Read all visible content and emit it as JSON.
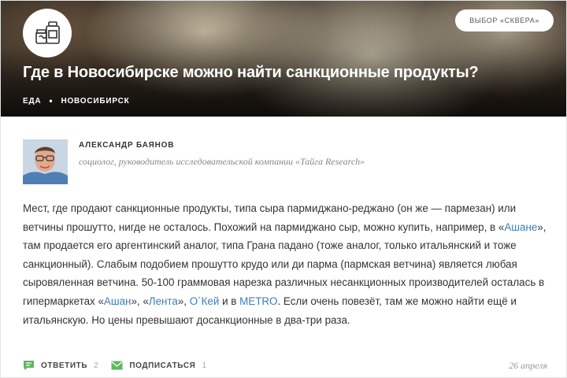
{
  "hero": {
    "choice_button": "ВЫБОР «СКВЕРА»",
    "title": "Где в Новосибирске можно найти санкционные продукты?",
    "tags": [
      "ЕДА",
      "НОВОСИБИРСК"
    ]
  },
  "author": {
    "name": "АЛЕКСАНДР БАЯНОВ",
    "role": "социолог, руководитель исследовательской компании «Тайга Research»"
  },
  "body": {
    "t1": "Мест, где продают санкционные продукты, типа сыра пармиджано-реджано (он же — пармезан) или ветчины прошутто, нигде не осталось. Похожий на пармиджано сыр, можно купить, например, в «",
    "link_ashan_1": "Ашане",
    "t2": "», там продается его аргентинский аналог, типа Грана падано (тоже аналог, только итальянский и тоже санкционный). Слабым подобием прошутто крудо или ди парма (пармская ветчина) является любая сыровяленная ветчина. 50-100 граммовая нарезка различных несанкционных производителей осталась в гипермаркетах «",
    "link_ashan_2": "Ашан",
    "t3": "», «",
    "link_lenta": "Лента",
    "t4": "», ",
    "link_okey": "О`Кей",
    "t5": " и в ",
    "link_metro": "METRO",
    "t6": ". Если очень повезёт, там же можно найти ещё и итальянскую. Но цены превышают досанкционные в два-три раза."
  },
  "footer": {
    "comment_label": "ОТВЕТИТЬ",
    "comment_count": "2",
    "subscribe_label": "ПОДПИСАТЬСЯ",
    "subscribe_count": "1",
    "date": "26 апреля"
  },
  "colors": {
    "link": "#3f7cb8",
    "icon_green": "#5cb85c"
  },
  "icons": [
    "logo-food-icon",
    "comment-icon",
    "mail-icon",
    "avatar-photo"
  ]
}
